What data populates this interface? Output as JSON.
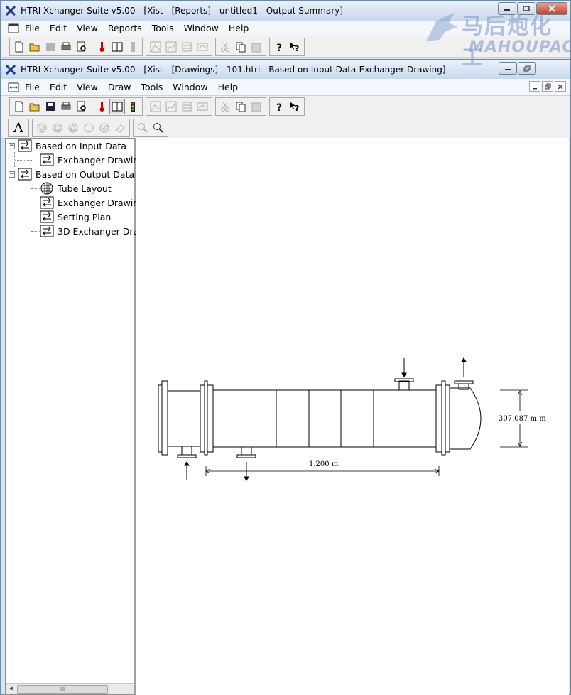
{
  "back_window": {
    "title": "HTRI Xchanger Suite v5.00 - [Xist - [Reports] - untitled1 - Output Summary]",
    "menu": [
      "File",
      "Edit",
      "View",
      "Reports",
      "Tools",
      "Window",
      "Help"
    ]
  },
  "front_window": {
    "title": "HTRI Xchanger Suite v5.00 - [Xist - [Drawings] - 101.htri - Based on Input Data-Exchanger Drawing]",
    "menu": [
      "File",
      "Edit",
      "View",
      "Draw",
      "Tools",
      "Window",
      "Help"
    ],
    "draw_toolbar_text_tool": "A"
  },
  "tree": {
    "input_group": "Based on Input Data",
    "input_exchanger": "Exchanger Drawin",
    "output_group": "Based on Output Data",
    "tube_layout": "Tube Layout",
    "output_exchanger": "Exchanger Drawin",
    "setting_plan": "Setting Plan",
    "exchanger_3d": "3D Exchanger Dra",
    "expand_symbol": "−",
    "scroll_grip": "III"
  },
  "drawing": {
    "diameter_label": "307.087 m m",
    "length_label": "1.200 m"
  },
  "watermark": {
    "chinese": "马后炮化工",
    "english": "MAHOUPAO"
  },
  "colors": {
    "title_gradient_top": "#e9f1fa",
    "close_button": "#c1432c",
    "drawing_stroke": "#000000"
  }
}
